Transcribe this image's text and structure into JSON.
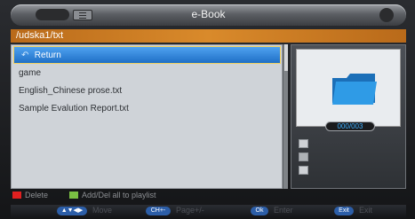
{
  "window": {
    "title": "e-Book"
  },
  "path": "/udska1/txt",
  "files": [
    {
      "name": "Return",
      "selected": true
    },
    {
      "name": "game",
      "selected": false
    },
    {
      "name": "English_Chinese prose.txt",
      "selected": false
    },
    {
      "name": "Sample Evalution Report.txt",
      "selected": false
    }
  ],
  "preview": {
    "counter": "000/003"
  },
  "hints": {
    "delete_label": "Delete",
    "playlist_label": "Add/Del all to playlist",
    "delete_color": "#e02020",
    "playlist_color": "#7ac043"
  },
  "keys": [
    {
      "key": "▲▼◀▶",
      "label": "Move"
    },
    {
      "key": "CH+-",
      "label": "Page+/-"
    },
    {
      "key": "Ok",
      "label": "Enter"
    },
    {
      "key": "Exit",
      "label": "Exit"
    }
  ],
  "colors": {
    "accent": "#d98a2b",
    "selection": "#2f86dc",
    "counter_text": "#3fb0ff"
  }
}
